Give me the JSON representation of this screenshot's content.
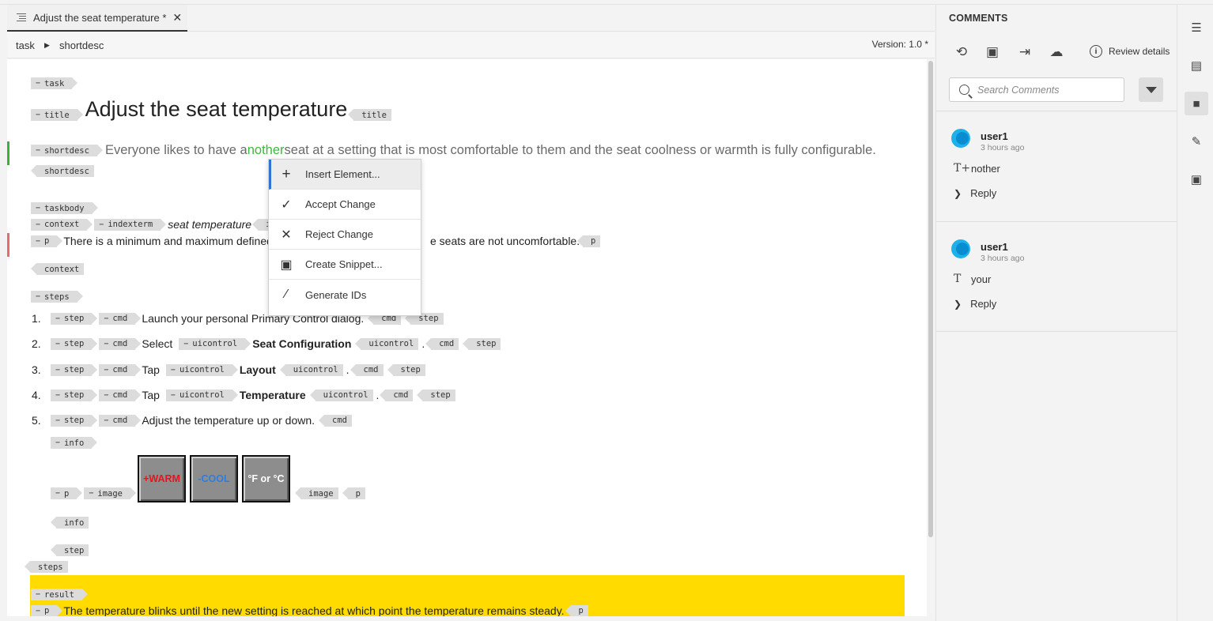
{
  "tab": {
    "title": "Adjust the seat temperature *",
    "close": "✕"
  },
  "breadcrumb": {
    "items": [
      "task",
      "shortdesc"
    ],
    "version": "Version: 1.0 *"
  },
  "doc": {
    "title_text": "Adjust the seat temperature",
    "shortdesc_pre": "Everyone likes to have a",
    "shortdesc_ins": "nother",
    "shortdesc_post": " seat at a setting that is most comfortable to them and the seat coolness or warmth is fully configurable.",
    "indexterm_text": "seat temperature",
    "indexterm_close_fragment": "in",
    "context_p_pre": "There is a minimum and maximum defined",
    "context_p_post": "e seats are not uncomfortable.",
    "steps": [
      {
        "num": "1.",
        "text_pre": "Launch your personal Primary Control dialog."
      },
      {
        "num": "2.",
        "text_pre": "Select",
        "ui": "Seat Configuration"
      },
      {
        "num": "3.",
        "text_pre": "Tap",
        "ui": "Layout"
      },
      {
        "num": "4.",
        "text_pre": "Tap",
        "ui": "Temperature"
      },
      {
        "num": "5.",
        "text_pre": "Adjust the temperature up or down."
      }
    ],
    "images": [
      "+WARM",
      "-COOL",
      "°F or °C"
    ],
    "result_p": "The temperature blinks until the new setting is reached at which point the temperature remains steady.",
    "tags": {
      "task": "task",
      "title": "title",
      "shortdesc": "shortdesc",
      "taskbody": "taskbody",
      "context": "context",
      "indexterm": "indexterm",
      "p": "p",
      "steps": "steps",
      "step": "step",
      "cmd": "cmd",
      "uicontrol": "uicontrol",
      "info": "info",
      "image": "image",
      "result": "result"
    },
    "period": "."
  },
  "context_menu": {
    "items": [
      {
        "icon": "+",
        "label": "Insert Element..."
      },
      {
        "icon": "✓",
        "label": "Accept Change"
      },
      {
        "icon": "✕",
        "label": "Reject Change"
      },
      {
        "icon": "▣",
        "label": "Create Snippet..."
      },
      {
        "icon": "⁄",
        "label": "Generate IDs"
      }
    ]
  },
  "comments_panel": {
    "title": "COMMENTS",
    "review_details": "Review details",
    "search_placeholder": "Search Comments",
    "comments": [
      {
        "user": "user1",
        "time": "3 hours ago",
        "type_icon": "T+",
        "content": "nother",
        "reply": "Reply"
      },
      {
        "user": "user1",
        "time": "3 hours ago",
        "type_icon": "T",
        "content": "your",
        "reply": "Reply"
      }
    ]
  },
  "colors": {
    "accent": "#2e74d3",
    "insert_text": "#3cb93c",
    "highlight": "#ffdb00",
    "change_bar_green": "#35b535",
    "change_bar_red": "#e76b6b"
  }
}
